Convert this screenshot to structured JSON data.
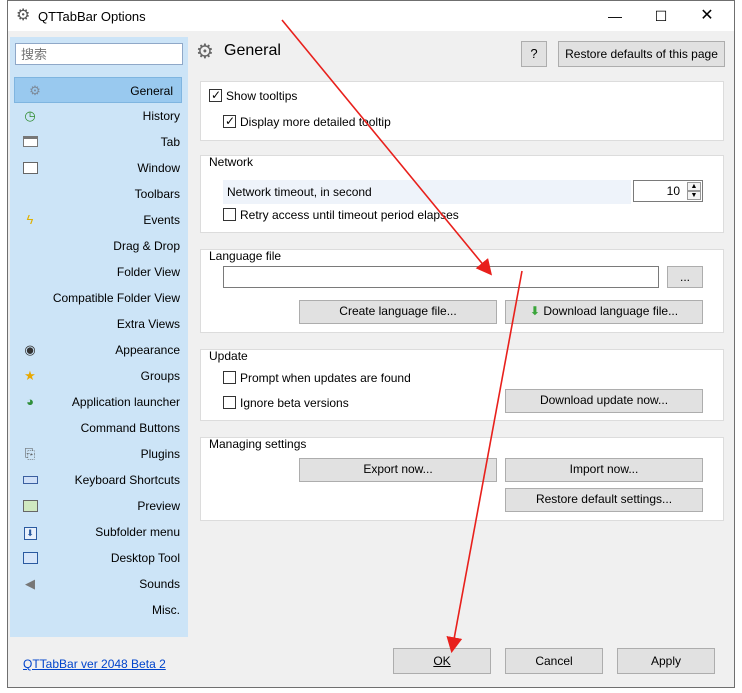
{
  "window": {
    "title": "QTTabBar Options",
    "controls": {
      "minimize": "—",
      "maximize": "☐",
      "close": "✕"
    }
  },
  "sidebar": {
    "search_placeholder": "搜索",
    "items": [
      {
        "label": "General",
        "icon": "gear-icon",
        "active": true
      },
      {
        "label": "History",
        "icon": "history-icon"
      },
      {
        "label": "Tab",
        "icon": "tab-icon"
      },
      {
        "label": "Window",
        "icon": "window-icon"
      },
      {
        "label": "Toolbars",
        "icon": ""
      },
      {
        "label": "Events",
        "icon": "lightning-icon"
      },
      {
        "label": "Drag & Drop",
        "icon": ""
      },
      {
        "label": "Folder View",
        "icon": ""
      },
      {
        "label": "Compatible Folder View",
        "icon": ""
      },
      {
        "label": "Extra Views",
        "icon": ""
      },
      {
        "label": "Appearance",
        "icon": "eye-icon"
      },
      {
        "label": "Groups",
        "icon": "star-icon"
      },
      {
        "label": "Application launcher",
        "icon": "launcher-icon"
      },
      {
        "label": "Command Buttons",
        "icon": ""
      },
      {
        "label": "Plugins",
        "icon": "plugin-icon"
      },
      {
        "label": "Keyboard Shortcuts",
        "icon": "keyboard-icon"
      },
      {
        "label": "Preview",
        "icon": "preview-icon"
      },
      {
        "label": "Subfolder menu",
        "icon": "subfolder-icon"
      },
      {
        "label": "Desktop Tool",
        "icon": "desktop-icon"
      },
      {
        "label": "Sounds",
        "icon": "speaker-icon"
      },
      {
        "label": "Misc.",
        "icon": ""
      }
    ]
  },
  "page": {
    "title": "General",
    "help_label": "?",
    "restore_label": "Restore defaults of this page"
  },
  "tooltips_group": {
    "show_tooltips": "Show tooltips",
    "detailed_tooltip": "Display more detailed tooltip"
  },
  "network": {
    "title": "Network",
    "timeout_label": "Network timeout, in second",
    "timeout_value": "10",
    "retry_label": "Retry access until timeout period elapses"
  },
  "language": {
    "title": "Language file",
    "file_path": "",
    "browse_label": "...",
    "create_label": "Create language file...",
    "download_label": "Download language file..."
  },
  "update": {
    "title": "Update",
    "prompt_label": "Prompt when updates are found",
    "ignore_beta_label": "Ignore beta versions",
    "download_update_label": "Download update now..."
  },
  "managing": {
    "title": "Managing settings",
    "export_label": "Export now...",
    "import_label": "Import now...",
    "restore_default_label": "Restore default settings..."
  },
  "footer": {
    "version": "QTTabBar ver 2048 Beta 2",
    "ok": "OK",
    "cancel": "Cancel",
    "apply": "Apply"
  },
  "colors": {
    "sidebar_bg": "#cce4f7",
    "selected_bg": "#99c9ef",
    "annotation": "#e8201c"
  }
}
